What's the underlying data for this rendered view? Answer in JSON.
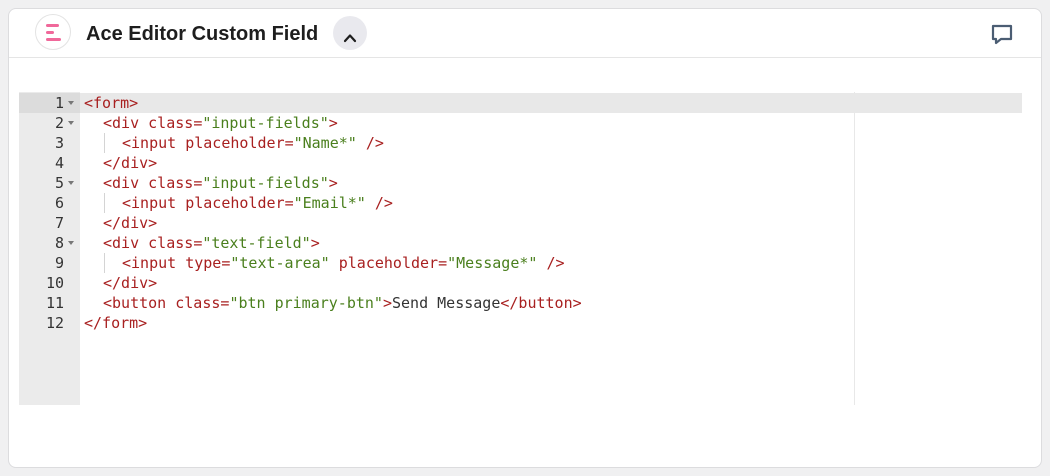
{
  "header": {
    "title": "Ace Editor Custom Field",
    "logo_icon": "menu-lines-logo-icon",
    "collapse_icon": "chevron-up-icon",
    "feedback_icon": "comment-icon"
  },
  "colors": {
    "logo_pink": "#f0689a",
    "tag": "#a82020",
    "string": "#4a7f1d",
    "gutter_bg": "#ebebeb",
    "active_line": "#e8e8e8"
  },
  "editor": {
    "mode": "html",
    "lines": [
      {
        "number": "1",
        "foldable": true,
        "indent": 0,
        "tokens": [
          [
            "tag",
            "<form>"
          ]
        ]
      },
      {
        "number": "2",
        "foldable": true,
        "indent": 1,
        "tokens": [
          [
            "tag",
            "<div"
          ],
          [
            "txt",
            " "
          ],
          [
            "attr",
            "class"
          ],
          [
            "tag",
            "="
          ],
          [
            "str",
            "\"input-fields\""
          ],
          [
            "tag",
            ">"
          ]
        ]
      },
      {
        "number": "3",
        "foldable": false,
        "indent": 2,
        "tokens": [
          [
            "tag",
            "<input"
          ],
          [
            "txt",
            " "
          ],
          [
            "attr",
            "placeholder"
          ],
          [
            "tag",
            "="
          ],
          [
            "str",
            "\"Name*\""
          ],
          [
            "txt",
            " "
          ],
          [
            "tag",
            "/>"
          ]
        ]
      },
      {
        "number": "4",
        "foldable": false,
        "indent": 1,
        "tokens": [
          [
            "tag",
            "</div>"
          ]
        ]
      },
      {
        "number": "5",
        "foldable": true,
        "indent": 1,
        "tokens": [
          [
            "tag",
            "<div"
          ],
          [
            "txt",
            " "
          ],
          [
            "attr",
            "class"
          ],
          [
            "tag",
            "="
          ],
          [
            "str",
            "\"input-fields\""
          ],
          [
            "tag",
            ">"
          ]
        ]
      },
      {
        "number": "6",
        "foldable": false,
        "indent": 2,
        "tokens": [
          [
            "tag",
            "<input"
          ],
          [
            "txt",
            " "
          ],
          [
            "attr",
            "placeholder"
          ],
          [
            "tag",
            "="
          ],
          [
            "str",
            "\"Email*\""
          ],
          [
            "txt",
            " "
          ],
          [
            "tag",
            "/>"
          ]
        ]
      },
      {
        "number": "7",
        "foldable": false,
        "indent": 1,
        "tokens": [
          [
            "tag",
            "</div>"
          ]
        ]
      },
      {
        "number": "8",
        "foldable": true,
        "indent": 1,
        "tokens": [
          [
            "tag",
            "<div"
          ],
          [
            "txt",
            " "
          ],
          [
            "attr",
            "class"
          ],
          [
            "tag",
            "="
          ],
          [
            "str",
            "\"text-field\""
          ],
          [
            "tag",
            ">"
          ]
        ]
      },
      {
        "number": "9",
        "foldable": false,
        "indent": 2,
        "tokens": [
          [
            "tag",
            "<input"
          ],
          [
            "txt",
            " "
          ],
          [
            "attr",
            "type"
          ],
          [
            "tag",
            "="
          ],
          [
            "str",
            "\"text-area\""
          ],
          [
            "txt",
            " "
          ],
          [
            "attr",
            "placeholder"
          ],
          [
            "tag",
            "="
          ],
          [
            "str",
            "\"Message*\""
          ],
          [
            "txt",
            " "
          ],
          [
            "tag",
            "/>"
          ]
        ]
      },
      {
        "number": "10",
        "foldable": false,
        "indent": 1,
        "tokens": [
          [
            "tag",
            "</div>"
          ]
        ]
      },
      {
        "number": "11",
        "foldable": false,
        "indent": 1,
        "tokens": [
          [
            "tag",
            "<button"
          ],
          [
            "txt",
            " "
          ],
          [
            "attr",
            "class"
          ],
          [
            "tag",
            "="
          ],
          [
            "str",
            "\"btn primary-btn\""
          ],
          [
            "tag",
            ">"
          ],
          [
            "txt",
            "Send Message"
          ],
          [
            "tag",
            "</button>"
          ]
        ]
      },
      {
        "number": "12",
        "foldable": false,
        "indent": 0,
        "tokens": [
          [
            "tag",
            "</form>"
          ]
        ]
      }
    ]
  }
}
